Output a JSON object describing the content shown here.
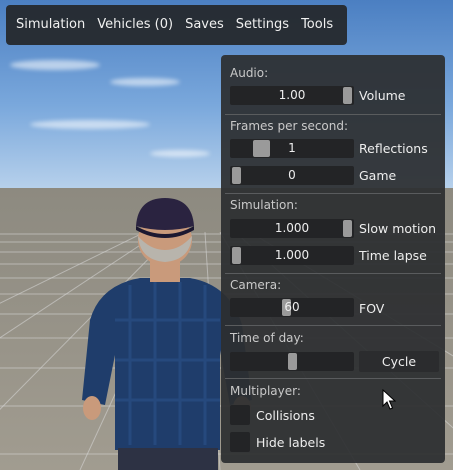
{
  "menubar": {
    "items": [
      "Simulation",
      "Vehicles (0)",
      "Saves",
      "Settings",
      "Tools"
    ]
  },
  "panel": {
    "audio": {
      "title": "Audio:",
      "volume": {
        "value": "1.00",
        "label": "Volume",
        "level": 1.0
      }
    },
    "fps": {
      "title": "Frames per second:",
      "reflections": {
        "value": "1",
        "label": "Reflections",
        "level": 0.2
      },
      "game": {
        "value": "0",
        "label": "Game",
        "level": 0.0
      }
    },
    "simulation": {
      "title": "Simulation:",
      "slow_motion": {
        "value": "1.000",
        "label": "Slow motion",
        "level": 1.0
      },
      "time_lapse": {
        "value": "1.000",
        "label": "Time lapse",
        "level": 0.0
      }
    },
    "camera": {
      "title": "Camera:",
      "fov": {
        "value": "60",
        "label": "FOV",
        "level": 0.45
      }
    },
    "time_of_day": {
      "title": "Time of day:",
      "level": 0.5,
      "cycle_label": "Cycle"
    },
    "multiplayer": {
      "title": "Multiplayer:",
      "collisions": {
        "label": "Collisions",
        "checked": false
      },
      "hide_labels": {
        "label": "Hide labels",
        "checked": false
      }
    }
  },
  "colors": {
    "panel_bg": "#2c2e30",
    "field_bg": "#232426",
    "slider_handle": "#9a9a9a",
    "sky": "#6d9bd4",
    "ground": "#9a958a"
  },
  "icons": {
    "cursor": "mouse-pointer-icon"
  }
}
